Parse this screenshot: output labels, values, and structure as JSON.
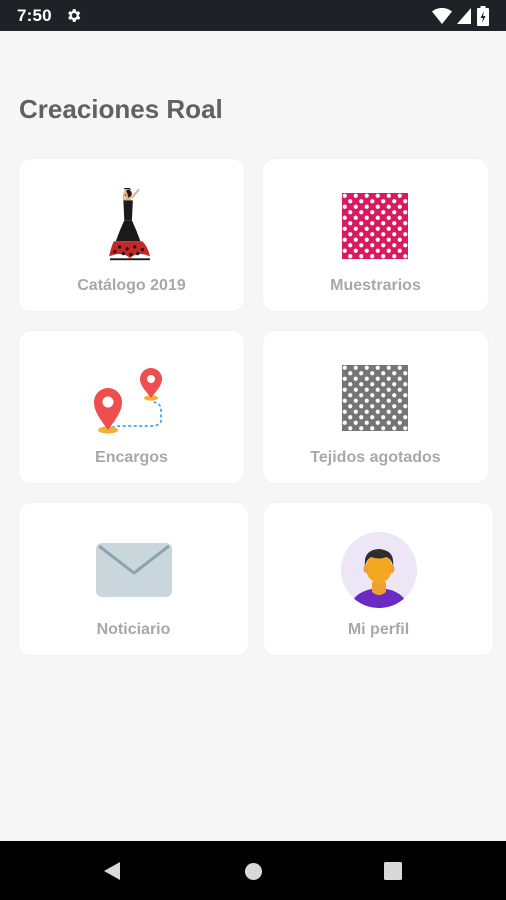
{
  "status_bar": {
    "time": "7:50"
  },
  "app": {
    "title": "Creaciones Roal"
  },
  "tiles": [
    {
      "label": "Catálogo 2019",
      "icon": "flamenco-dancer-icon"
    },
    {
      "label": "Muestrarios",
      "icon": "pink-polka-dot-fabric-icon"
    },
    {
      "label": "Encargos",
      "icon": "map-route-pins-icon"
    },
    {
      "label": "Tejidos agotados",
      "icon": "grey-polka-dot-fabric-icon"
    },
    {
      "label": "Noticiario",
      "icon": "envelope-icon"
    },
    {
      "label": "Mi perfil",
      "icon": "user-avatar-icon"
    }
  ],
  "colors": {
    "status_bar": "#1f2126",
    "background": "#f6f6f6",
    "card": "#ffffff",
    "title": "#616161",
    "label": "#a8a8a8",
    "pink_fabric": "#d81b60",
    "grey_fabric": "#757575",
    "pin_red": "#ef4e4e",
    "envelope": "#c9d6dc",
    "avatar_shirt": "#6a2bc2"
  }
}
